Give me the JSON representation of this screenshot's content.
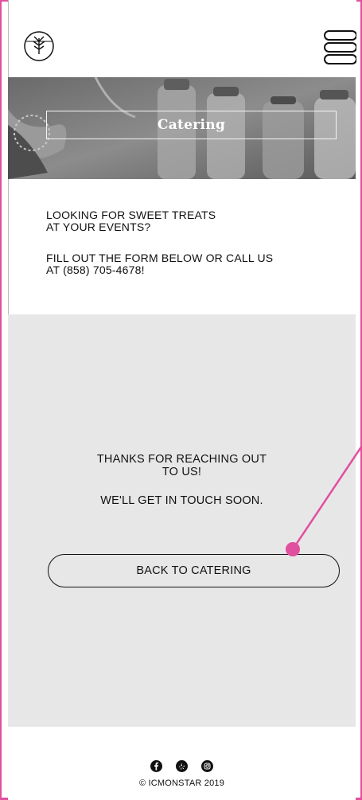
{
  "header": {
    "logo_icon": "leaf-logo-icon",
    "menu_icon": "hamburger-menu-icon"
  },
  "hero": {
    "title": "Catering"
  },
  "intro": {
    "line1": "LOOKING FOR SWEET TREATS",
    "line2": "AT YOUR EVENTS?",
    "line3": "FILL OUT THE FORM BELOW OR CALL US",
    "line4": "AT (858) 705-4678!"
  },
  "confirmation": {
    "thanks_line1": "THANKS FOR REACHING OUT",
    "thanks_line2": "TO US!",
    "soon": "WE'LL GET IN TOUCH SOON.",
    "back_button": "BACK TO CATERING"
  },
  "footer": {
    "social_icons": [
      "facebook-icon",
      "yelp-icon",
      "instagram-icon"
    ],
    "copyright": "© ICMONSTAR 2019"
  },
  "colors": {
    "frame_accent": "#e14f9f",
    "panel_bg": "#e7e7e7",
    "text": "#111111"
  }
}
